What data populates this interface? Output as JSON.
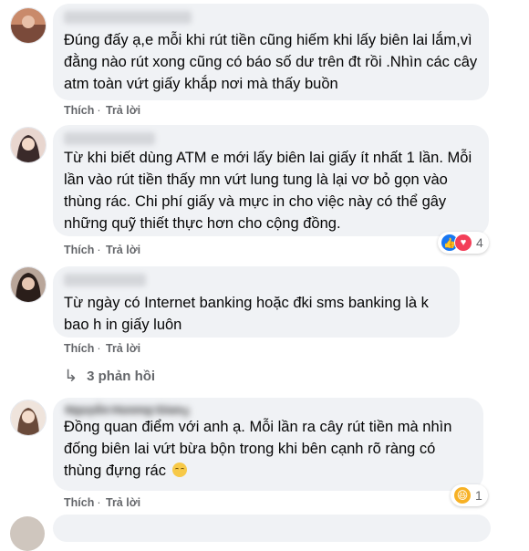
{
  "comments": [
    {
      "text": "Đúng đấy ạ,e mỗi khi rút tiền cũng hiếm khi lấy biên lai lắm,vì đằng nào rút xong cũng có báo số dư trên đt rồi .Nhìn các cây atm toàn vứt giấy khắp nơi mà thấy buồn",
      "like_label": "Thích",
      "reply_label": "Trả lời",
      "avatar_colors": [
        "#c98a6a",
        "#7a4a3a"
      ]
    },
    {
      "text": "Từ khi biết dùng ATM e mới lấy biên lai giấy ít nhất 1 lần. Mỗi lần vào rút tiền thấy mn vứt lung tung là lại vơ bỏ gọn vào thùng rác. Chi phí giấy và mực in cho việc này có thể gây những quỹ thiết thực hơn cho cộng đồng.",
      "like_label": "Thích",
      "reply_label": "Trả lời",
      "reaction_count": "4",
      "avatar_colors": [
        "#e8d6cf",
        "#3a2a2a"
      ]
    },
    {
      "text": "Từ ngày có Internet banking hoặc đki sms banking là k bao h in giấy luôn",
      "like_label": "Thích",
      "reply_label": "Trả lời",
      "replies_label": "3 phản hồi",
      "avatar_colors": [
        "#b9a69a",
        "#2a1e1a"
      ]
    },
    {
      "name_ghost": "Nguyễn Hương Giang",
      "text": "Đồng quan điểm với anh ạ. Mỗi lần ra cây rút tiền mà nhìn đống biên lai vứt bừa bộn trong khi bên cạnh rõ ràng có thùng đựng rác",
      "like_label": "Thích",
      "reply_label": "Trả lời",
      "reaction_count": "1",
      "avatar_colors": [
        "#efe4dc",
        "#6a4a3a"
      ]
    }
  ]
}
